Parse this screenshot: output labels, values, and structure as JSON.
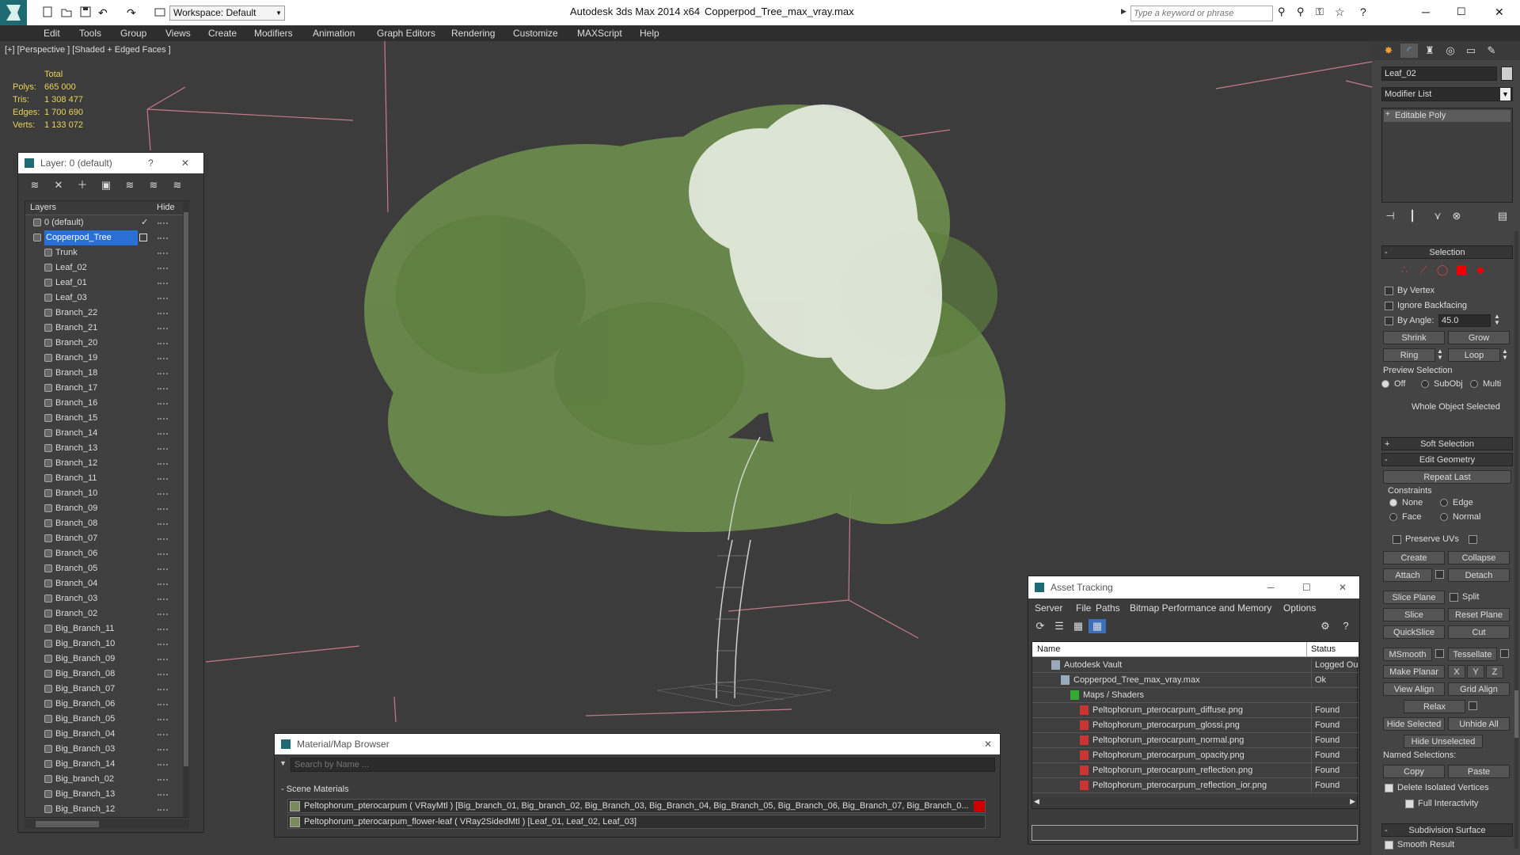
{
  "titlebar": {
    "app": "Autodesk 3ds Max  2014 x64",
    "file": "Copperpod_Tree_max_vray.max",
    "workspace": "Workspace: Default",
    "search_placeholder": "Type a keyword or phrase"
  },
  "menu": [
    "Edit",
    "Tools",
    "Group",
    "Views",
    "Create",
    "Modifiers",
    "Animation",
    "Graph Editors",
    "Rendering",
    "Customize",
    "MAXScript",
    "Help"
  ],
  "viewport": {
    "label": "[+] [Perspective ] [Shaded + Edged Faces ]",
    "stats": {
      "header": "Total",
      "polys_label": "Polys:",
      "polys": "665 000",
      "tris_label": "Tris:",
      "tris": "1 308 477",
      "edges_label": "Edges:",
      "edges": "1 700 690",
      "verts_label": "Verts:",
      "verts": "1 133 072"
    }
  },
  "layer_panel": {
    "title": "Layer: 0 (default)",
    "help": "?",
    "col_layers": "Layers",
    "col_hide": "Hide",
    "items": [
      {
        "name": "0 (default)",
        "level": 0
      },
      {
        "name": "Copperpod_Tree",
        "level": 0
      },
      {
        "name": "Trunk",
        "level": 1
      },
      {
        "name": "Leaf_02",
        "level": 1
      },
      {
        "name": "Leaf_01",
        "level": 1
      },
      {
        "name": "Leaf_03",
        "level": 1
      },
      {
        "name": "Branch_22",
        "level": 1
      },
      {
        "name": "Branch_21",
        "level": 1
      },
      {
        "name": "Branch_20",
        "level": 1
      },
      {
        "name": "Branch_19",
        "level": 1
      },
      {
        "name": "Branch_18",
        "level": 1
      },
      {
        "name": "Branch_17",
        "level": 1
      },
      {
        "name": "Branch_16",
        "level": 1
      },
      {
        "name": "Branch_15",
        "level": 1
      },
      {
        "name": "Branch_14",
        "level": 1
      },
      {
        "name": "Branch_13",
        "level": 1
      },
      {
        "name": "Branch_12",
        "level": 1
      },
      {
        "name": "Branch_11",
        "level": 1
      },
      {
        "name": "Branch_10",
        "level": 1
      },
      {
        "name": "Branch_09",
        "level": 1
      },
      {
        "name": "Branch_08",
        "level": 1
      },
      {
        "name": "Branch_07",
        "level": 1
      },
      {
        "name": "Branch_06",
        "level": 1
      },
      {
        "name": "Branch_05",
        "level": 1
      },
      {
        "name": "Branch_04",
        "level": 1
      },
      {
        "name": "Branch_03",
        "level": 1
      },
      {
        "name": "Branch_02",
        "level": 1
      },
      {
        "name": "Big_Branch_11",
        "level": 1
      },
      {
        "name": "Big_Branch_10",
        "level": 1
      },
      {
        "name": "Big_Branch_09",
        "level": 1
      },
      {
        "name": "Big_Branch_08",
        "level": 1
      },
      {
        "name": "Big_Branch_07",
        "level": 1
      },
      {
        "name": "Big_Branch_06",
        "level": 1
      },
      {
        "name": "Big_Branch_05",
        "level": 1
      },
      {
        "name": "Big_Branch_04",
        "level": 1
      },
      {
        "name": "Big_Branch_03",
        "level": 1
      },
      {
        "name": "Big_Branch_14",
        "level": 1
      },
      {
        "name": "Big_branch_02",
        "level": 1
      },
      {
        "name": "Big_Branch_13",
        "level": 1
      },
      {
        "name": "Big_Branch_12",
        "level": 1
      }
    ]
  },
  "material_browser": {
    "title": "Material/Map Browser",
    "search_placeholder": "Search by Name ...",
    "section": "- Scene Materials",
    "materials": [
      "Peltophorum_pterocarpum  ( VRayMtl ) [Big_branch_01, Big_branch_02, Big_Branch_03, Big_Branch_04, Big_Branch_05, Big_Branch_06, Big_Branch_07, Big_Branch_0...",
      "Peltophorum_pterocarpum_flower-leaf  ( VRay2SidedMtl ) [Leaf_01, Leaf_02, Leaf_03]"
    ]
  },
  "asset_tracking": {
    "title": "Asset Tracking",
    "menu": [
      "Server",
      "File",
      "Paths",
      "Bitmap Performance and Memory",
      "Options"
    ],
    "col_name": "Name",
    "col_status": "Status",
    "rows": [
      {
        "name": "Autodesk Vault",
        "status": "Logged Ou",
        "indent": 1
      },
      {
        "name": "Copperpod_Tree_max_vray.max",
        "status": "Ok",
        "indent": 2
      },
      {
        "name": "Maps / Shaders",
        "status": "",
        "indent": 3
      },
      {
        "name": "Peltophorum_pterocarpum_diffuse.png",
        "status": "Found",
        "indent": 4
      },
      {
        "name": "Peltophorum_pterocarpum_glossi.png",
        "status": "Found",
        "indent": 4
      },
      {
        "name": "Peltophorum_pterocarpum_normal.png",
        "status": "Found",
        "indent": 4
      },
      {
        "name": "Peltophorum_pterocarpum_opacity.png",
        "status": "Found",
        "indent": 4
      },
      {
        "name": "Peltophorum_pterocarpum_reflection.png",
        "status": "Found",
        "indent": 4
      },
      {
        "name": "Peltophorum_pterocarpum_reflection_ior.png",
        "status": "Found",
        "indent": 4
      }
    ]
  },
  "command_panel": {
    "object_name": "Leaf_02",
    "modifier_list": "Modifier List",
    "stack_item": "Editable Poly",
    "selection": {
      "header": "Selection",
      "by_vertex": "By Vertex",
      "ignore_backfacing": "Ignore Backfacing",
      "by_angle": "By Angle:",
      "angle_value": "45.0",
      "shrink": "Shrink",
      "grow": "Grow",
      "ring": "Ring",
      "loop": "Loop",
      "preview_label": "Preview Selection",
      "off": "Off",
      "subobj": "SubObj",
      "multi": "Multi",
      "whole": "Whole Object Selected"
    },
    "soft_selection": "Soft Selection",
    "edit_geometry": {
      "header": "Edit Geometry",
      "repeat_last": "Repeat Last",
      "constraints": "Constraints",
      "none": "None",
      "edge": "Edge",
      "face": "Face",
      "normal": "Normal",
      "preserve_uvs": "Preserve UVs",
      "create": "Create",
      "collapse": "Collapse",
      "attach": "Attach",
      "detach": "Detach",
      "slice_plane": "Slice Plane",
      "split": "Split",
      "slice": "Slice",
      "reset_plane": "Reset Plane",
      "quickslice": "QuickSlice",
      "cut": "Cut",
      "msmooth": "MSmooth",
      "tessellate": "Tessellate",
      "make_planar": "Make Planar",
      "x": "X",
      "y": "Y",
      "z": "Z",
      "view_align": "View Align",
      "grid_align": "Grid Align",
      "relax": "Relax",
      "hide_selected": "Hide Selected",
      "unhide_all": "Unhide All",
      "hide_unselected": "Hide Unselected",
      "named_selections": "Named Selections:",
      "copy": "Copy",
      "paste": "Paste",
      "delete_isolated": "Delete Isolated Vertices",
      "full_interactivity": "Full Interactivity"
    },
    "subdivision_surface": "Subdivision Surface",
    "smooth_result": "Smooth Result"
  }
}
